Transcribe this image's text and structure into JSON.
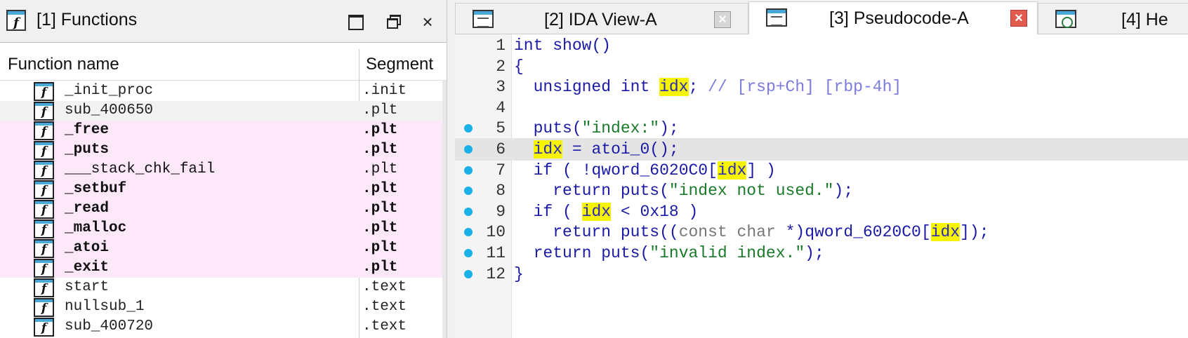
{
  "functions_panel": {
    "title": "[1] Functions",
    "columns": {
      "name": "Function name",
      "segment": "Segment"
    },
    "rows": [
      {
        "name": "_init_proc",
        "segment": ".init",
        "style": "normal"
      },
      {
        "name": "sub_400650",
        "segment": ".plt",
        "style": "selected"
      },
      {
        "name": "_free",
        "segment": ".plt",
        "style": "highlight"
      },
      {
        "name": "_puts",
        "segment": ".plt",
        "style": "highlight"
      },
      {
        "name": "___stack_chk_fail",
        "segment": ".plt",
        "style": "highlight-light"
      },
      {
        "name": "_setbuf",
        "segment": ".plt",
        "style": "highlight"
      },
      {
        "name": "_read",
        "segment": ".plt",
        "style": "highlight"
      },
      {
        "name": "_malloc",
        "segment": ".plt",
        "style": "highlight"
      },
      {
        "name": "_atoi",
        "segment": ".plt",
        "style": "highlight"
      },
      {
        "name": "_exit",
        "segment": ".plt",
        "style": "highlight"
      },
      {
        "name": "start",
        "segment": ".text",
        "style": "normal"
      },
      {
        "name": "nullsub_1",
        "segment": ".text",
        "style": "normal"
      },
      {
        "name": "sub_400720",
        "segment": ".text",
        "style": "normal"
      }
    ],
    "icon_glyph": "f"
  },
  "tabs": [
    {
      "label": "[2] IDA View-A",
      "icon": "ida-view-icon",
      "active": false
    },
    {
      "label": "[3] Pseudocode-A",
      "icon": "pseudocode-icon",
      "active": true
    },
    {
      "label": "[4] He",
      "icon": "hex-view-icon",
      "active": false
    }
  ],
  "close_glyph": "×",
  "pseudocode": {
    "lines": [
      {
        "n": "1",
        "dot": false,
        "text": "int show()"
      },
      {
        "n": "2",
        "dot": false,
        "text": "{"
      },
      {
        "n": "3",
        "dot": false,
        "text": "  unsigned int idx; // [rsp+Ch] [rbp-4h]"
      },
      {
        "n": "4",
        "dot": false,
        "text": ""
      },
      {
        "n": "5",
        "dot": true,
        "text": "  puts(\"index:\");"
      },
      {
        "n": "6",
        "dot": true,
        "text": "  idx = atoi_0();"
      },
      {
        "n": "7",
        "dot": true,
        "text": "  if ( !qword_6020C0[idx] )"
      },
      {
        "n": "8",
        "dot": true,
        "text": "    return puts(\"index not used.\");"
      },
      {
        "n": "9",
        "dot": true,
        "text": "  if ( idx < 0x18 )"
      },
      {
        "n": "10",
        "dot": true,
        "text": "    return puts((const char *)qword_6020C0[idx]);"
      },
      {
        "n": "11",
        "dot": true,
        "text": "  return puts(\"invalid index.\");"
      },
      {
        "n": "12",
        "dot": true,
        "text": "}"
      }
    ],
    "current_line": "6",
    "highlight_token": "idx"
  },
  "colors": {
    "keyword": "#1a1aa6",
    "string": "#1a7a2a",
    "comment": "#7a7ae0",
    "highlight": "#f6f400",
    "breakpoint_dot": "#1ab0e8",
    "row_highlight": "#fde8fa"
  }
}
